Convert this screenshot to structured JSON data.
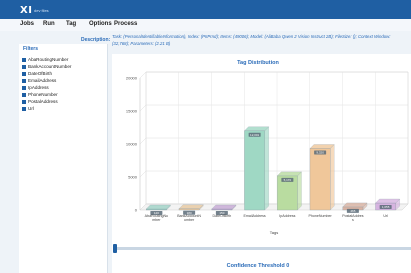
{
  "app": {
    "logo": "XI",
    "logo_sub": "dev files"
  },
  "menu": [
    "Jobs",
    "Run",
    "Tag",
    "Options",
    "Process"
  ],
  "description": {
    "label": "Description:",
    "text": "Task: (PersonalIdentifiableInformation), Index: (PIIPrnd); Items: (49006); Model: (AliBaba Qwen 2 Vision Instruct 2B); FileSize: (); Context Window: (32,768); Parameters: (2.21 B)"
  },
  "filters": {
    "title": "Filters",
    "items": [
      "AbaRoutingNumber",
      "BankAccountNumber",
      "DateOfBirth",
      "EmailAddress",
      "IpAddress",
      "PhoneNumber",
      "PostalAddress",
      "Url"
    ]
  },
  "chart_data": {
    "type": "bar",
    "title": "Tag Distribution",
    "xlabel": "Tags",
    "ylabel": "",
    "categories": [
      "AbaRoutingNumber",
      "BankAccountNumber",
      "DateOfBirth",
      "EmailAddress",
      "IpAddress",
      "PhoneNumber",
      "PostalAddress",
      "Url"
    ],
    "values": [
      120,
      180,
      150,
      12001,
      5170,
      9320,
      465,
      1055
    ],
    "value_labels": [
      "120",
      "180",
      "150",
      "12,001",
      "5,170",
      "9,320",
      "465",
      "1,055"
    ],
    "colors": [
      "#9fd3c7",
      "#e8c9a0",
      "#c7a9d6",
      "#9fd8c4",
      "#b9dca0",
      "#f0c79a",
      "#d9b3a3",
      "#d6b3e0"
    ],
    "yticks": [
      0,
      5000,
      10000,
      15000,
      20000
    ],
    "ylim": [
      0,
      20000
    ],
    "grid": true
  },
  "confidence": {
    "label": "Confidence Threshold 0"
  }
}
